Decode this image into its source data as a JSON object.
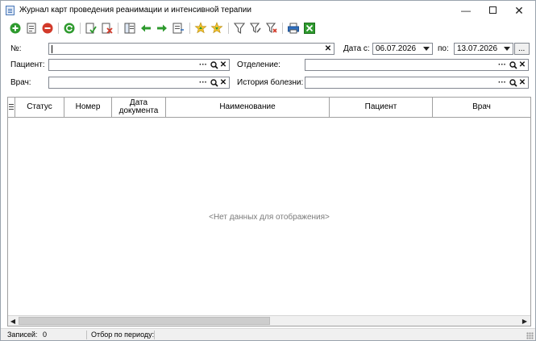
{
  "window": {
    "title": "Журнал карт проведения реанимации и интенсивной терапии",
    "minimize": "—",
    "close": "✕"
  },
  "toolbar": {
    "icons": [
      "add-icon",
      "edit-icon",
      "delete-icon",
      "refresh-icon",
      "approve-icon",
      "cancel-approve-icon",
      "columns-icon",
      "arrow-left-icon",
      "arrow-right-icon",
      "export-icon",
      "star-up-icon",
      "star-down-icon",
      "filter-icon",
      "filter-edit-icon",
      "filter-clear-icon",
      "print-icon",
      "excel-icon"
    ]
  },
  "filters": {
    "number_label": "№:",
    "number_value": "",
    "date_from_label": "Дата с:",
    "date_from_value": "06.07.2026",
    "date_to_label": "по:",
    "date_to_value": "13.07.2026",
    "date_extra_button": "...",
    "patient_label": "Пациент:",
    "patient_value": "",
    "department_label": "Отделение:",
    "department_value": "",
    "doctor_label": "Врач:",
    "doctor_value": "",
    "history_label": "История болезни:",
    "history_value": "",
    "ellipsis": "···",
    "clear": "✕"
  },
  "grid": {
    "columns": [
      "Статус",
      "Номер",
      "Дата документа",
      "Наименование",
      "Пациент",
      "Врач"
    ],
    "empty_text": "<Нет данных для отображения>"
  },
  "status": {
    "records_label": "Записей:",
    "records_value": "0",
    "period_label": "Отбор по периоду:"
  },
  "colors": {
    "green": "#2e9a2e",
    "red": "#d23a2a",
    "yellow": "#f2c12e",
    "blue": "#2f6fbf"
  }
}
